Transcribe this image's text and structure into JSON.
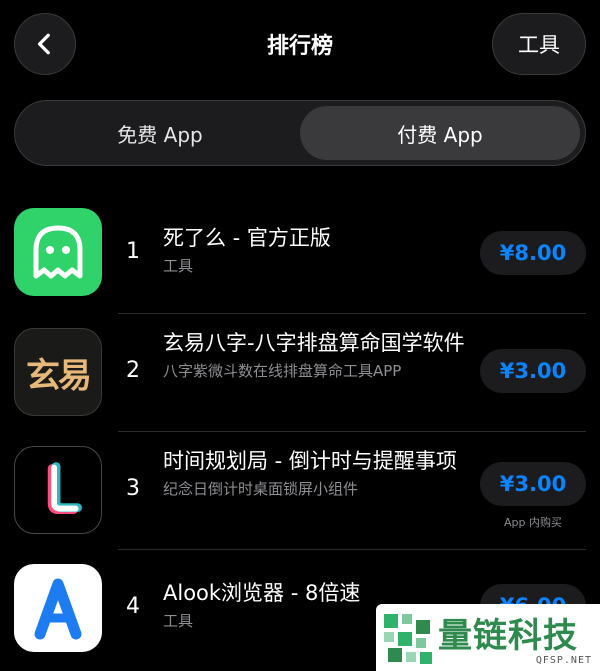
{
  "header": {
    "title": "排行榜",
    "tools_label": "工具"
  },
  "segment": {
    "tabs": [
      {
        "label": "免费 App",
        "active": false
      },
      {
        "label": "付费 App",
        "active": true
      }
    ]
  },
  "apps": [
    {
      "rank": "1",
      "name": "死了么 - 官方正版",
      "subtitle": "工具",
      "price": "¥8.00",
      "icon": "ghost-icon"
    },
    {
      "rank": "2",
      "name": "玄易八字-八字排盘算命国学软件",
      "subtitle": "八字紫微斗数在线排盘算命工具APP",
      "price": "¥3.00",
      "icon": "xuanyi-logo-icon",
      "icon_text": "玄易"
    },
    {
      "rank": "3",
      "name": "时间规划局 - 倒计时与提醒事项",
      "subtitle": "纪念日倒计时桌面锁屏小组件",
      "price": "¥3.00",
      "icon": "letter-l-icon",
      "note": "App 内购买"
    },
    {
      "rank": "4",
      "name": "Alook浏览器 - 8倍速",
      "subtitle": "工具",
      "price": "¥6.00",
      "icon": "letter-a-icon"
    }
  ],
  "watermark": {
    "text": "量链科技",
    "domain": "QFSP.NET"
  },
  "colors": {
    "accent": "#0a84ff",
    "background": "#000000",
    "button_bg": "#1c1c1e",
    "secondary_text": "#8e8e93",
    "ghost_green": "#2fd36a",
    "watermark_green": "#2f8a4e"
  }
}
